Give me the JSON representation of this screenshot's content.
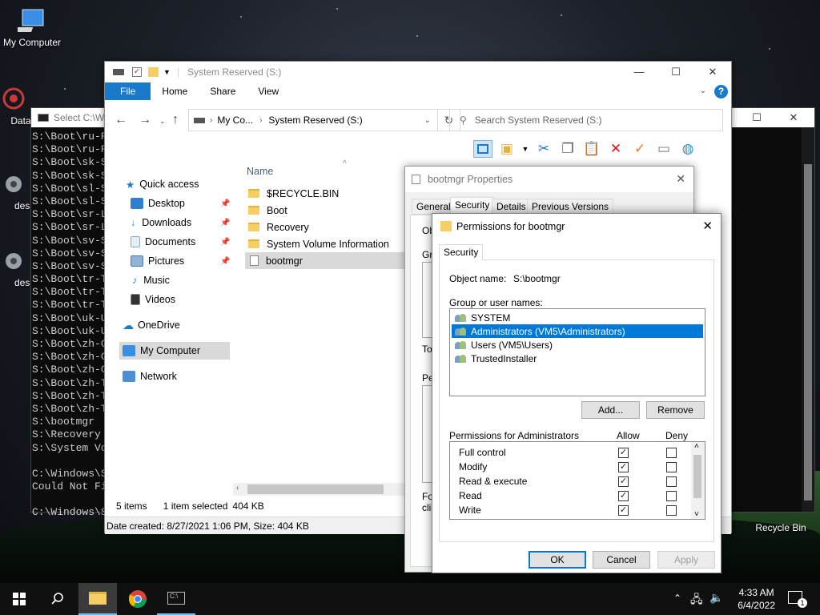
{
  "desktop": {
    "icons": [
      {
        "label": "My Computer"
      },
      {
        "label": "DataW"
      },
      {
        "label": "desl"
      },
      {
        "label": "desl"
      },
      {
        "label": "Recycle Bin"
      }
    ]
  },
  "cmd": {
    "title": "Select C:\\W",
    "lines": [
      "S:\\Boot\\ru-R",
      "S:\\Boot\\ru-R",
      "S:\\Boot\\sk-S",
      "S:\\Boot\\sk-S",
      "S:\\Boot\\sl-S",
      "S:\\Boot\\sl-S",
      "S:\\Boot\\sr-L",
      "S:\\Boot\\sr-L",
      "S:\\Boot\\sv-S",
      "S:\\Boot\\sv-S",
      "S:\\Boot\\sv-S",
      "S:\\Boot\\tr-T",
      "S:\\Boot\\tr-T",
      "S:\\Boot\\tr-T",
      "S:\\Boot\\uk-U",
      "S:\\Boot\\uk-U",
      "S:\\Boot\\zh-C",
      "S:\\Boot\\zh-C",
      "S:\\Boot\\zh-C",
      "S:\\Boot\\zh-T",
      "S:\\Boot\\zh-T",
      "S:\\Boot\\zh-T",
      "S:\\bootmgr",
      "S:\\Recovery",
      "S:\\System Vo",
      "",
      "C:\\Windows\\S",
      "Could Not Fi",
      "",
      "C:\\Windows\\S"
    ]
  },
  "explorer": {
    "title": "System Reserved (S:)",
    "ribbon_tabs": [
      "File",
      "Home",
      "Share",
      "View"
    ],
    "address_parts": [
      "My Co...",
      "System Reserved (S:)"
    ],
    "search_placeholder": "Search System Reserved (S:)",
    "nav": [
      {
        "label": "Quick access"
      },
      {
        "label": "Desktop"
      },
      {
        "label": "Downloads"
      },
      {
        "label": "Documents"
      },
      {
        "label": "Pictures"
      },
      {
        "label": "Music"
      },
      {
        "label": "Videos"
      },
      {
        "label": "OneDrive"
      },
      {
        "label": "My Computer"
      },
      {
        "label": "Network"
      }
    ],
    "column_name": "Name",
    "files": [
      {
        "name": "$RECYCLE.BIN"
      },
      {
        "name": "Boot"
      },
      {
        "name": "Recovery"
      },
      {
        "name": "System Volume Information"
      },
      {
        "name": "bootmgr"
      }
    ],
    "status_items": "5 items",
    "status_selected": "1 item selected",
    "status_size": "404 KB",
    "status_details": "Date created: 8/27/2021 1:06 PM, Size: 404 KB"
  },
  "properties": {
    "title": "bootmgr Properties",
    "tabs": [
      "General",
      "Security",
      "Details",
      "Previous Versions"
    ],
    "frag_obj": "Obj",
    "frag_gro": "Gro",
    "frag_to": "To",
    "frag_pe": "Pe",
    "frag_fo": "Fo",
    "frag_cli": "clic"
  },
  "permissions": {
    "title": "Permissions for bootmgr",
    "tab": "Security",
    "object_label": "Object name:",
    "object_value": "S:\\bootmgr",
    "group_label": "Group or user names:",
    "users": [
      {
        "name": "SYSTEM"
      },
      {
        "name": "Administrators (VM5\\Administrators)"
      },
      {
        "name": "Users (VM5\\Users)"
      },
      {
        "name": "TrustedInstaller"
      }
    ],
    "add_label": "Add...",
    "remove_label": "Remove",
    "perm_for_label": "Permissions for Administrators",
    "allow_label": "Allow",
    "deny_label": "Deny",
    "perms": [
      {
        "name": "Full control",
        "allow": true,
        "deny": false
      },
      {
        "name": "Modify",
        "allow": true,
        "deny": false
      },
      {
        "name": "Read & execute",
        "allow": true,
        "deny": false
      },
      {
        "name": "Read",
        "allow": true,
        "deny": false
      },
      {
        "name": "Write",
        "allow": true,
        "deny": false
      }
    ],
    "ok_label": "OK",
    "cancel_label": "Cancel",
    "apply_label": "Apply"
  },
  "taskbar": {
    "time": "4:33 AM",
    "date": "6/4/2022",
    "notification_count": "1"
  },
  "colors": {
    "accent": "#0078d7",
    "file_tab": "#1979ca"
  }
}
